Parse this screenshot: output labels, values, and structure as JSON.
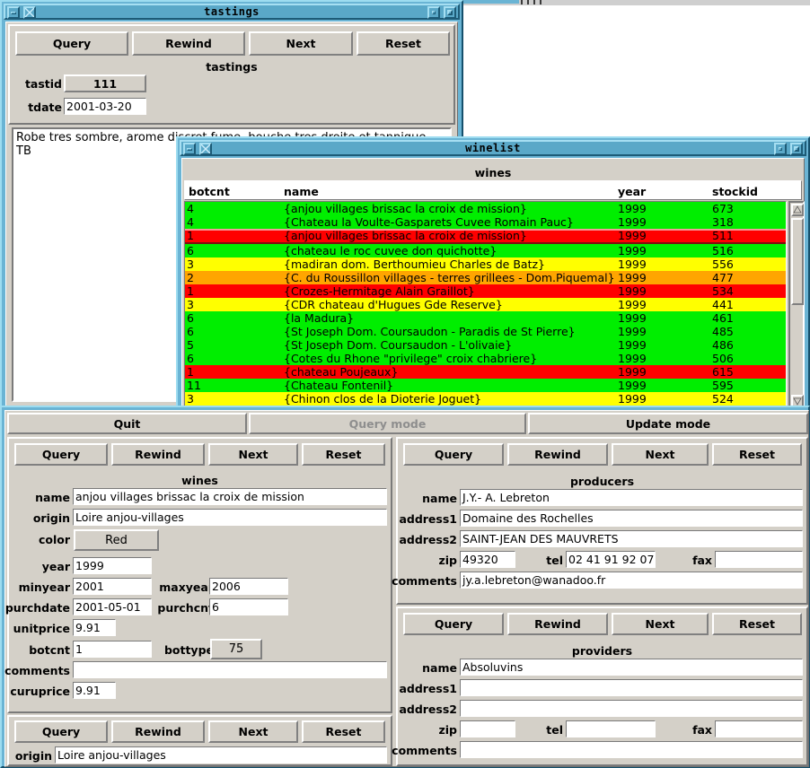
{
  "desktop": {
    "background": "#ffffff"
  },
  "windows": {
    "tastings": {
      "title": "tastings",
      "buttons": [
        "Query",
        "Rewind",
        "Next",
        "Reset"
      ],
      "form_title": "tastings",
      "fields": [
        {
          "label": "tastid",
          "value": "111",
          "kind": "button"
        },
        {
          "label": "tdate",
          "value": "2001-03-20",
          "kind": "entry"
        }
      ],
      "notes": "Robe tres sombre, arome discret fume, bouche tres droite et tannique\nTB"
    },
    "winelist": {
      "title": "winelist",
      "form_title": "wines",
      "scrollbar": {
        "up_icon": "triangle-up-icon",
        "down_icon": "triangle-down-icon"
      }
    },
    "main": {
      "modes": [
        {
          "label": "Quit",
          "enabled": true
        },
        {
          "label": "Query mode",
          "enabled": false
        },
        {
          "label": "Update mode",
          "enabled": true
        }
      ],
      "wines": {
        "buttons": [
          "Query",
          "Rewind",
          "Next",
          "Reset"
        ],
        "form_title": "wines",
        "fields": [
          {
            "label": "name",
            "value": "anjou villages brissac la croix de mission"
          },
          {
            "label": "origin",
            "value": "Loire anjou-villages"
          },
          {
            "label": "color",
            "value": "Red",
            "kind": "button"
          },
          {
            "label": "year",
            "value": "1999"
          },
          {
            "label": "minyear",
            "value": "2001"
          },
          {
            "label": "maxyear",
            "value": "2006"
          },
          {
            "label": "purchdate",
            "value": "2001-05-01"
          },
          {
            "label": "purchcnt",
            "value": "6"
          },
          {
            "label": "unitprice",
            "value": "9.91"
          },
          {
            "label": "botcnt",
            "value": "1"
          },
          {
            "label": "bottype",
            "value": "75",
            "kind": "button"
          },
          {
            "label": "comments",
            "value": ""
          },
          {
            "label": "curuprice",
            "value": "9.91"
          }
        ]
      },
      "origins": {
        "buttons": [
          "Query",
          "Rewind",
          "Next",
          "Reset"
        ],
        "fields": [
          {
            "label": "origin",
            "value": "Loire anjou-villages"
          }
        ]
      },
      "producers": {
        "buttons": [
          "Query",
          "Rewind",
          "Next",
          "Reset"
        ],
        "form_title": "producers",
        "fields": [
          {
            "label": "name",
            "value": "J.Y.- A. Lebreton"
          },
          {
            "label": "address1",
            "value": "Domaine des Rochelles"
          },
          {
            "label": "address2",
            "value": "SAINT-JEAN DES MAUVRETS"
          },
          {
            "label": "zip",
            "value": "49320"
          },
          {
            "label": "tel",
            "value": "02 41 91 92 07"
          },
          {
            "label": "fax",
            "value": ""
          },
          {
            "label": "comments",
            "value": "jy.a.lebreton@wanadoo.fr"
          }
        ]
      },
      "providers": {
        "buttons": [
          "Query",
          "Rewind",
          "Next",
          "Reset"
        ],
        "form_title": "providers",
        "fields": [
          {
            "label": "name",
            "value": "Absoluvins"
          },
          {
            "label": "address1",
            "value": ""
          },
          {
            "label": "address2",
            "value": ""
          },
          {
            "label": "zip",
            "value": ""
          },
          {
            "label": "tel",
            "value": ""
          },
          {
            "label": "fax",
            "value": ""
          },
          {
            "label": "comments",
            "value": ""
          }
        ]
      }
    }
  },
  "chart_data": {
    "type": "table",
    "title": "wines",
    "columns": [
      "botcnt",
      "name",
      "year",
      "stockid"
    ],
    "row_color_legend": {
      "green": "#00ee00",
      "yellow": "#ffff00",
      "orange": "#ffa500",
      "red": "#ff0000"
    },
    "rows": [
      {
        "botcnt": "4",
        "name": "{anjou villages brissac la croix de mission}",
        "year": "1999",
        "stockid": "673",
        "color": "#00ee00",
        "selected": false
      },
      {
        "botcnt": "4",
        "name": "{Chateau la Voulte-Gasparets Cuvee Romain Pauc}",
        "year": "1999",
        "stockid": "318",
        "color": "#00ee00",
        "selected": false
      },
      {
        "botcnt": "1",
        "name": "{anjou villages brissac la croix de mission}",
        "year": "1999",
        "stockid": "511",
        "color": "#ff0000",
        "selected": true
      },
      {
        "botcnt": "6",
        "name": "{chateau le roc cuvee don quichotte}",
        "year": "1999",
        "stockid": "516",
        "color": "#00ee00",
        "selected": false
      },
      {
        "botcnt": "3",
        "name": "{madiran dom. Berthoumieu Charles de Batz}",
        "year": "1999",
        "stockid": "556",
        "color": "#ffff00",
        "selected": false
      },
      {
        "botcnt": "2",
        "name": "{C. du Roussillon villages - terres grillees - Dom.Piquemal}",
        "year": "1999",
        "stockid": "477",
        "color": "#ffa500",
        "selected": false
      },
      {
        "botcnt": "1",
        "name": "{Crozes-Hermitage Alain Graillot}",
        "year": "1999",
        "stockid": "534",
        "color": "#ff0000",
        "selected": false
      },
      {
        "botcnt": "3",
        "name": "{CDR chateau d'Hugues Gde Reserve}",
        "year": "1999",
        "stockid": "441",
        "color": "#ffff00",
        "selected": false
      },
      {
        "botcnt": "6",
        "name": "{la Madura}",
        "year": "1999",
        "stockid": "461",
        "color": "#00ee00",
        "selected": false
      },
      {
        "botcnt": "6",
        "name": "{St Joseph Dom. Coursaudon - Paradis de St Pierre}",
        "year": "1999",
        "stockid": "485",
        "color": "#00ee00",
        "selected": false
      },
      {
        "botcnt": "5",
        "name": "{St Joseph Dom. Coursaudon - L'olivaie}",
        "year": "1999",
        "stockid": "486",
        "color": "#00ee00",
        "selected": false
      },
      {
        "botcnt": "6",
        "name": "{Cotes du Rhone \"privilege\" croix chabriere}",
        "year": "1999",
        "stockid": "506",
        "color": "#00ee00",
        "selected": false
      },
      {
        "botcnt": "1",
        "name": "{chateau Poujeaux}",
        "year": "1999",
        "stockid": "615",
        "color": "#ff0000",
        "selected": false
      },
      {
        "botcnt": "11",
        "name": "{Chateau Fontenil}",
        "year": "1999",
        "stockid": "595",
        "color": "#00ee00",
        "selected": false
      },
      {
        "botcnt": "3",
        "name": "{Chinon clos de la Dioterie Joguet}",
        "year": "1999",
        "stockid": "524",
        "color": "#ffff00",
        "selected": false
      }
    ]
  }
}
